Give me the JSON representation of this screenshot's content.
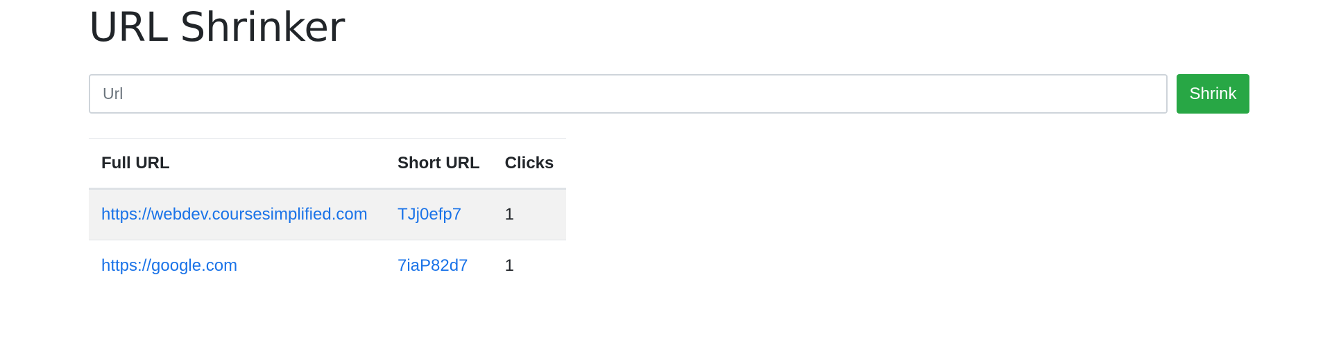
{
  "page": {
    "title": "URL Shrinker"
  },
  "form": {
    "input_placeholder": "Url",
    "input_value": "",
    "submit_label": "Shrink"
  },
  "table": {
    "headers": [
      "Full URL",
      "Short URL",
      "Clicks"
    ],
    "rows": [
      {
        "full_url": "https://webdev.coursesimplified.com",
        "short_url": "TJj0efp7",
        "clicks": "1"
      },
      {
        "full_url": "https://google.com",
        "short_url": "7iaP82d7",
        "clicks": "1"
      }
    ]
  },
  "colors": {
    "primary_button": "#28a745",
    "link": "#1a73e8",
    "striped_row": "#f2f2f2",
    "border": "#dee2e6"
  }
}
